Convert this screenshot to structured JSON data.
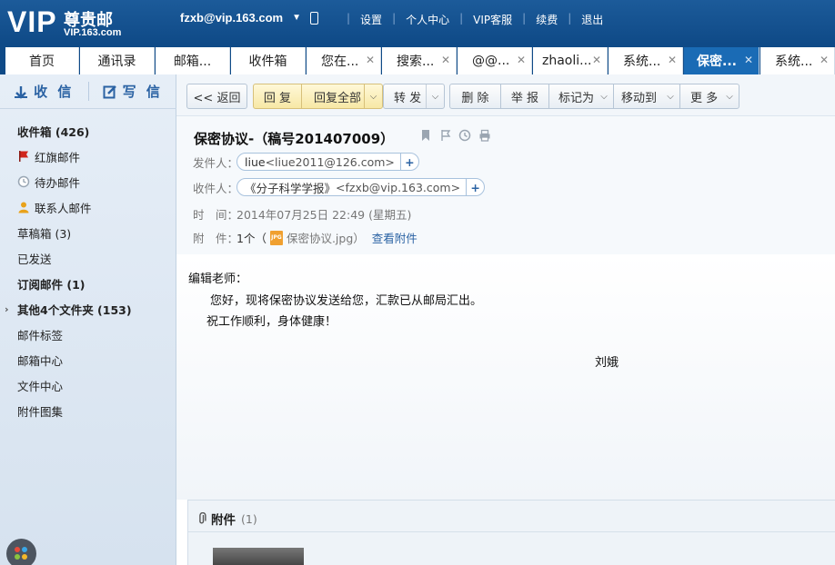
{
  "brand": {
    "vip": "VIP",
    "name_cn": "尊贵邮",
    "domain": "VIP.163.com"
  },
  "user": {
    "email": "fzxb@vip.163.com"
  },
  "top_links": [
    "设置",
    "个人中心",
    "VIP客服",
    "续费",
    "退出"
  ],
  "tabs": [
    {
      "label": "首页",
      "closable": false
    },
    {
      "label": "通讯录",
      "closable": false
    },
    {
      "label": "邮箱...",
      "closable": false
    },
    {
      "label": "收件箱",
      "closable": false
    },
    {
      "label": "您在...",
      "closable": true
    },
    {
      "label": "搜索...",
      "closable": true
    },
    {
      "label": "@@...",
      "closable": true
    },
    {
      "label": "zhaoli...",
      "closable": true
    },
    {
      "label": "系统...",
      "closable": true
    },
    {
      "label": "保密...",
      "closable": true,
      "active": true
    },
    {
      "label": "系统...",
      "closable": true
    }
  ],
  "sidebar": {
    "receive": "收 信",
    "compose": "写 信",
    "items": [
      {
        "label": "收件箱 (426)",
        "bold": true
      },
      {
        "label": "红旗邮件",
        "icon": "red-flag-icon"
      },
      {
        "label": "待办邮件",
        "icon": "clock-icon"
      },
      {
        "label": "联系人邮件",
        "icon": "person-icon"
      },
      {
        "label": "草稿箱 (3)"
      },
      {
        "label": "已发送"
      },
      {
        "label": "订阅邮件 (1)",
        "bold": true
      },
      {
        "label": "其他4个文件夹 (153)",
        "bold": true,
        "expandable": true
      },
      {
        "label": "邮件标签"
      },
      {
        "label": "邮箱中心"
      },
      {
        "label": "文件中心"
      },
      {
        "label": "附件图集"
      }
    ]
  },
  "toolbar": {
    "back": "<< 返回",
    "reply": "回 复",
    "reply_all": "回复全部",
    "forward": "转 发",
    "delete": "删 除",
    "report": "举 报",
    "mark_as": "标记为",
    "move_to": "移动到",
    "more": "更 多"
  },
  "mail": {
    "subject": "保密协议-（稿号201407009）",
    "from_label": "发件人：",
    "from_name": "liue",
    "from_email": "<liue2011@126.com>",
    "to_label": "收件人：",
    "to_name": "《分子科学学报》",
    "to_email": "<fzxb@vip.163.com>",
    "time_label": "时　间：",
    "time_value": "2014年07月25日 22:49 (星期五)",
    "attach_label": "附　件：",
    "attach_count": "1个（",
    "attach_name": "保密协议.jpg",
    "attach_close": "）",
    "view_attach": "查看附件",
    "body": {
      "greeting": "编辑老师：",
      "line1": "您好，现将保密协议发送给您，汇款已从邮局汇出。",
      "line2": "祝工作顺利，身体健康！",
      "signature": "刘娥"
    }
  },
  "attachments": {
    "title": "附件",
    "count": "(1)"
  },
  "colors": {
    "header_blue": "#0f4a87",
    "active_tab": "#1a6bb5",
    "link_blue": "#2a62a3",
    "flag_red": "#d0261d"
  }
}
